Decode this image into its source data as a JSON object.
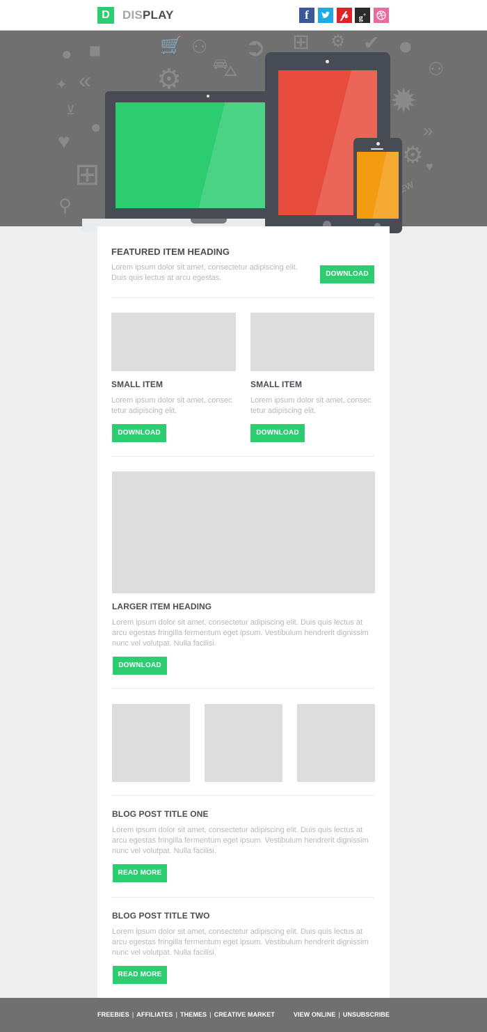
{
  "header": {
    "logo_letter": "D",
    "logo_prefix": "DIS",
    "logo_suffix": "PLAY",
    "social": [
      {
        "name": "facebook",
        "glyph": "f",
        "color": "#3b5998"
      },
      {
        "name": "twitter",
        "glyph": "t",
        "color": "#1eaae7"
      },
      {
        "name": "pinterest",
        "glyph": "p",
        "color": "#e02125"
      },
      {
        "name": "google-plus",
        "glyph": "g+",
        "color": "#2a2a2a"
      },
      {
        "name": "dribbble",
        "glyph": "◎",
        "color": "#ea6aa0"
      }
    ]
  },
  "hero": {
    "devices": {
      "laptop_screen_color": "#2ecc71",
      "tablet_screen_color": "#e84c3d",
      "phone_screen_color": "#f39c12"
    },
    "badge_text": "NEW"
  },
  "featured": {
    "heading": "FEATURED ITEM HEADING",
    "text": "Lorem ipsum dolor sit amet, consectetur adipiscing elit. Duis quis lectus at arcu egestas.",
    "button": "DOWNLOAD"
  },
  "small_items": [
    {
      "heading": "SMALL ITEM",
      "text": "Lorem ipsum dolor sit amet, consec tetur adipiscing elit.",
      "button": "DOWNLOAD"
    },
    {
      "heading": "SMALL ITEM",
      "text": "Lorem ipsum dolor sit amet, consec tetur adipiscing elit.",
      "button": "DOWNLOAD"
    }
  ],
  "larger_item": {
    "heading": "LARGER ITEM HEADING",
    "text": "Lorem ipsum dolor sit amet, consectetur adipiscing elit. Duis quis lectus at arcu egestas fringilla fermentum eget ipsum. Vestibulum hendrerit dignissim nunc vel volutpat. Nulla facilisi.",
    "button": "DOWNLOAD"
  },
  "blog_posts": [
    {
      "title": "BLOG POST TITLE ONE",
      "text": "Lorem ipsum dolor sit amet, consectetur adipiscing elit. Duis quis lectus at arcu egestas fringilla fermentum eget ipsum. Vestibulum hendrerit dignissim nunc vel volutpat. Nulla facilisi.",
      "button": "READ MORE"
    },
    {
      "title": "BLOG POST TITLE TWO",
      "text": "Lorem ipsum dolor sit amet, consectetur adipiscing elit. Duis quis lectus at arcu egestas fringilla fermentum eget ipsum. Vestibulum hendrerit dignissim nunc vel volutpat. Nulla facilisi.",
      "button": "READ MORE"
    }
  ],
  "footer": {
    "left_links": [
      "FREEBIES",
      "AFFILIATES",
      "THEMES",
      "CREATIVE MARKET"
    ],
    "right_links": [
      "VIEW ONLINE",
      "UNSUBSCRIBE"
    ],
    "separator": "|"
  },
  "colors": {
    "accent": "#2ecc71",
    "heading": "#4a4d52",
    "body_text": "#b8b8b8",
    "placeholder": "#dddddd",
    "hero_bg": "#707070",
    "page_bg": "#efefef"
  }
}
